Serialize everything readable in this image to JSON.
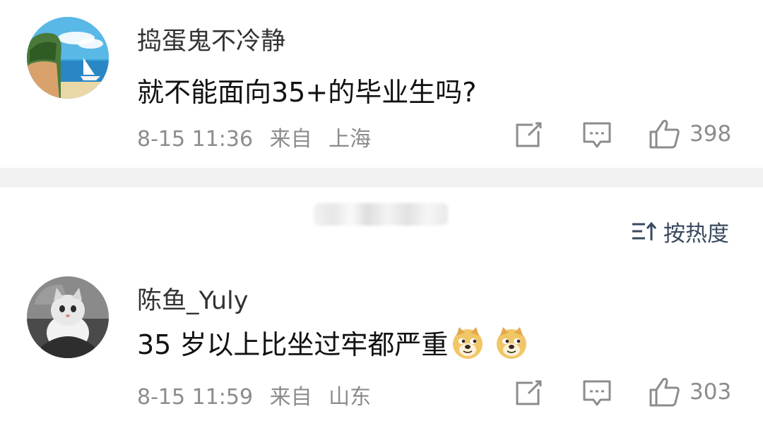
{
  "comments": [
    {
      "username": "捣蛋鬼不冷静",
      "text": "就不能面向35+的毕业生吗?",
      "date": "8-15 11:36",
      "source_prefix": "来自",
      "location": "上海",
      "likes": "398",
      "avatar_icon": "sailboat-sky-avatar"
    },
    {
      "username": "陈鱼_Yuly",
      "text": "35 岁以上比坐过牢都严重",
      "date": "8-15 11:59",
      "source_prefix": "来自",
      "location": "山东",
      "likes": "303",
      "avatar_icon": "cat-avatar",
      "emojis": [
        "doge-emoji",
        "doge-emoji"
      ]
    }
  ],
  "sort": {
    "label": "按热度",
    "icon": "sort-icon"
  },
  "colors": {
    "meta_gray": "#8c8c8c",
    "divider": "#f2f2f2",
    "sort_text": "#3a4a5e"
  }
}
